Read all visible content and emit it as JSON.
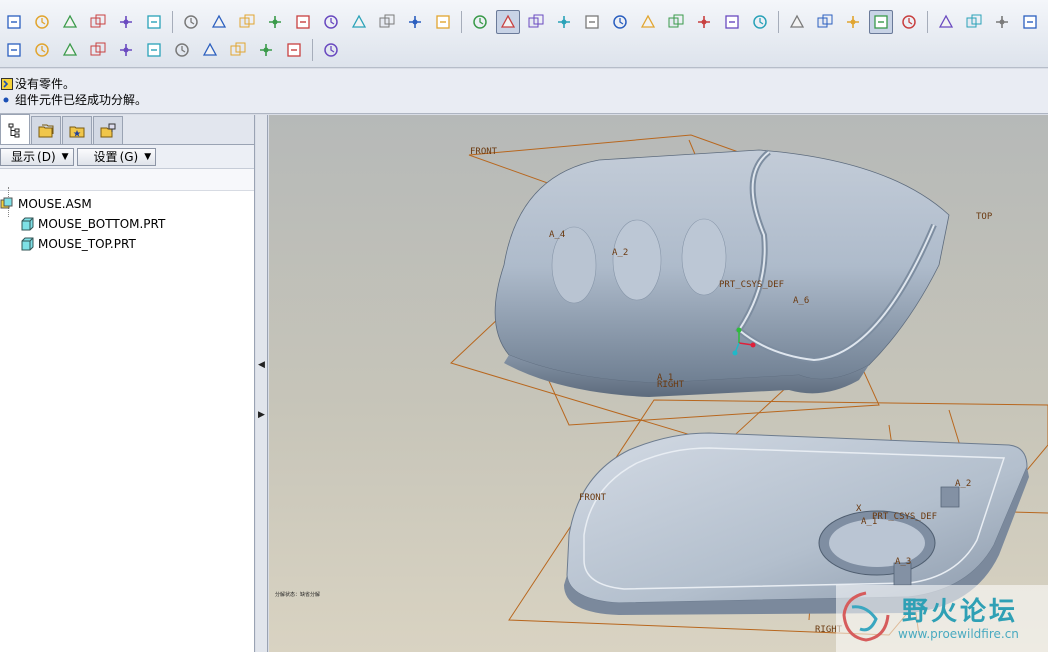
{
  "toolbar": {
    "row1": [
      "new-file-icon",
      "open-file-icon",
      "save-icon",
      "print-icon",
      "send-mail-icon",
      "recipients-icon",
      "undo-icon",
      "redo-icon",
      "cut-icon",
      "copy-icon",
      "paste-icon",
      "paste-special-icon",
      "regenerate-icon",
      "regen-manager-icon",
      "find-icon",
      "select-box-icon",
      "repaint-icon",
      "spin-center-icon",
      "orient-mode-icon",
      "pan-icon",
      "zoom-in-icon",
      "zoom-out-icon",
      "refit-icon",
      "reorient-icon",
      "saved-views-icon",
      "layers-icon",
      "view-manager-icon",
      "wireframe-icon",
      "hidden-line-icon",
      "no-hidden-icon",
      "shading-icon",
      "shading-edges-icon",
      "datum-planes-icon",
      "datum-axes-icon",
      "datum-points-icon",
      "csys-icon",
      "annotation-icon"
    ],
    "row2": [
      "appearance-icon",
      "environment-icon",
      "terrain-icon",
      "lights-icon",
      "perspective-icon",
      "scene-icon",
      "color-palette-icon",
      "shade-icon",
      "model-tree-icon",
      "user-icon",
      "datum-display-icon",
      "help-context-icon"
    ]
  },
  "messages": [
    {
      "icon": "prompt-icon",
      "text": "没有零件。"
    },
    {
      "icon": "bullet-icon",
      "text": "组件元件已经成功分解。"
    }
  ],
  "panel": {
    "tabs": [
      "model-tree-tab-icon",
      "folder-browser-tab-icon",
      "favorites-tab-icon",
      "connections-tab-icon"
    ],
    "show_label": "显示",
    "show_key": "(D)",
    "settings_label": "设置",
    "settings_key": "(G)",
    "tree": [
      {
        "level": 0,
        "label": "MOUSE.ASM",
        "icon": "assembly-icon"
      },
      {
        "level": 1,
        "label": "MOUSE_BOTTOM.PRT",
        "icon": "part-icon"
      },
      {
        "level": 1,
        "label": "MOUSE_TOP.PRT",
        "icon": "part-icon"
      }
    ]
  },
  "viewport": {
    "top_part_labels": {
      "front": "FRONT",
      "top": "TOP",
      "right": "RIGHT",
      "csys": "PRT_CSYS_DEF",
      "a4": "A_4",
      "a2": "A_2",
      "a6": "A_6",
      "a1": "A_1"
    },
    "bottom_part_labels": {
      "front": "FRONT",
      "right": "RIGHT",
      "csys": "PRT_CSYS_DEF",
      "a2": "A_2",
      "a3": "A_3",
      "a1": "A_1",
      "x": "X"
    },
    "note": "分解状态：缺省分解",
    "watermark_title": "野火论坛",
    "watermark_url": "www.proewildfire.cn"
  },
  "colors": {
    "datum": "#b8671e",
    "part": "#a8b6c6",
    "csys_x": "#e0203a",
    "csys_y": "#2ebd3a",
    "csys_z": "#20b8c8"
  }
}
